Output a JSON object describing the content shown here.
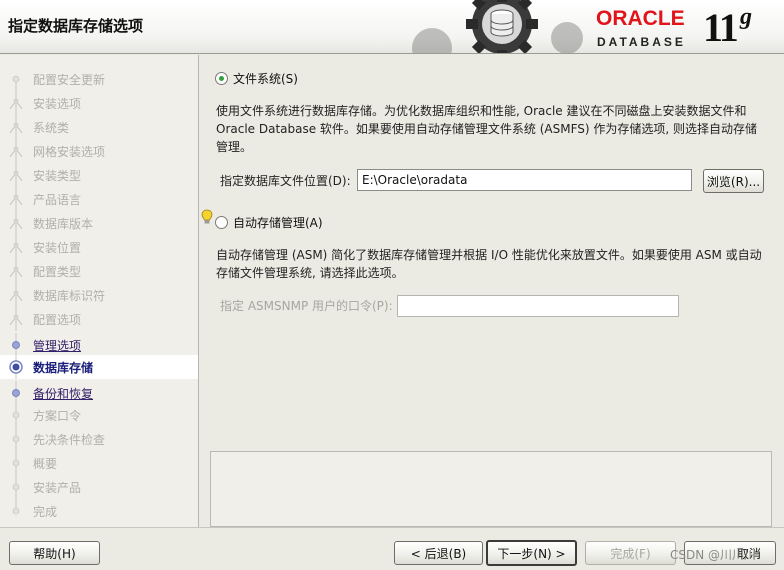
{
  "header": {
    "title": "指定数据库存储选项",
    "logo_oracle": "ORACLE",
    "logo_database": "DATABASE",
    "version_number": "11",
    "version_letter": "g"
  },
  "sidebar": {
    "steps": [
      {
        "label": "配置安全更新",
        "state": "done"
      },
      {
        "label": "安装选项",
        "state": "done"
      },
      {
        "label": "系统类",
        "state": "done"
      },
      {
        "label": "网格安装选项",
        "state": "done"
      },
      {
        "label": "安装类型",
        "state": "done"
      },
      {
        "label": "产品语言",
        "state": "done"
      },
      {
        "label": "数据库版本",
        "state": "done"
      },
      {
        "label": "安装位置",
        "state": "done"
      },
      {
        "label": "配置类型",
        "state": "done"
      },
      {
        "label": "数据库标识符",
        "state": "done"
      },
      {
        "label": "配置选项",
        "state": "done"
      },
      {
        "label": "管理选项",
        "state": "link"
      },
      {
        "label": "数据库存储",
        "state": "current"
      },
      {
        "label": "备份和恢复",
        "state": "link"
      },
      {
        "label": "方案口令",
        "state": "pending"
      },
      {
        "label": "先决条件检查",
        "state": "pending"
      },
      {
        "label": "概要",
        "state": "pending"
      },
      {
        "label": "安装产品",
        "state": "pending"
      },
      {
        "label": "完成",
        "state": "pending"
      }
    ]
  },
  "main": {
    "filesystem_radio": {
      "label": "文件系统(S)",
      "checked": true
    },
    "filesystem_desc": "使用文件系统进行数据库存储。为优化数据库组织和性能, Oracle 建议在不同磁盘上安装数据文件和 Oracle Database 软件。如果要使用自动存储管理文件系统 (ASMFS) 作为存储选项, 则选择自动存储管理。",
    "location_label": "指定数据库文件位置(D):",
    "location_value": "E:\\Oracle\\oradata",
    "browse_button": "浏览(R)...",
    "asm_radio": {
      "label": "自动存储管理(A)",
      "checked": false
    },
    "asm_desc": "自动存储管理 (ASM) 简化了数据库存储管理并根据 I/O 性能优化来放置文件。如果要使用 ASM 或自动存储文件管理系统, 请选择此选项。",
    "asmsnmp_label": "指定 ASMSNMP 用户的口令(P):",
    "asmsnmp_value": ""
  },
  "footer": {
    "help_button": "帮助(H)",
    "back_button": "< 后退(B)",
    "next_button": "下一步(N) >",
    "finish_button": "完成(F)",
    "cancel_button": "取消",
    "watermark": "CSDN @川川川"
  },
  "colors": {
    "oracle_red": "#e2141b",
    "selected_radio": "#33a13b",
    "current_step": "#1a1e7a"
  }
}
